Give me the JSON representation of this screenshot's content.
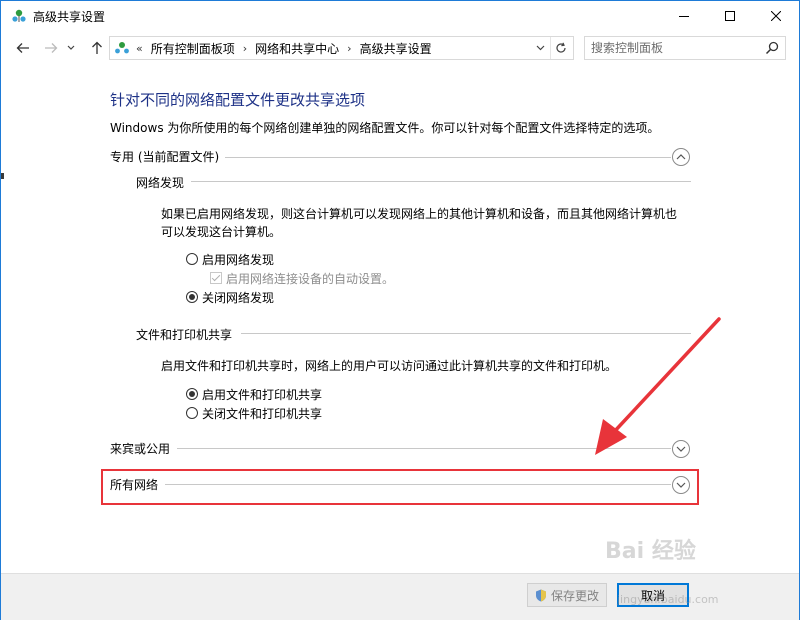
{
  "window": {
    "title": "高级共享设置"
  },
  "nav": {
    "crumb_prefix": "«",
    "crumbs": [
      "所有控制面板项",
      "网络和共享中心",
      "高级共享设置"
    ],
    "search_placeholder": "搜索控制面板"
  },
  "content": {
    "heading": "针对不同的网络配置文件更改共享选项",
    "intro": "Windows 为你所使用的每个网络创建单独的网络配置文件。你可以针对每个配置文件选择特定的选项。",
    "private": {
      "label": "专用 (当前配置文件)",
      "network_discovery": {
        "title": "网络发现",
        "desc_line1": "如果已启用网络发现，则这台计算机可以发现网络上的其他计算机和设备，而且其他网络计算机也",
        "desc_line2": "可以发现这台计算机。",
        "opt_on": "启用网络发现",
        "opt_auto": "启用网络连接设备的自动设置。",
        "opt_off": "关闭网络发现"
      },
      "file_sharing": {
        "title": "文件和打印机共享",
        "desc": "启用文件和打印机共享时，网络上的用户可以访问通过此计算机共享的文件和打印机。",
        "opt_on": "启用文件和打印机共享",
        "opt_off": "关闭文件和打印机共享"
      }
    },
    "guest": {
      "label": "来宾或公用"
    },
    "all": {
      "label": "所有网络"
    }
  },
  "footer": {
    "save_label": "保存更改",
    "cancel_label": "取消"
  },
  "watermark": {
    "text": "Bai 经验",
    "sub": "jingyan.baidu.com"
  },
  "colors": {
    "heading": "#1e3287",
    "highlight": "#e8343a",
    "accent": "#0078d7"
  }
}
